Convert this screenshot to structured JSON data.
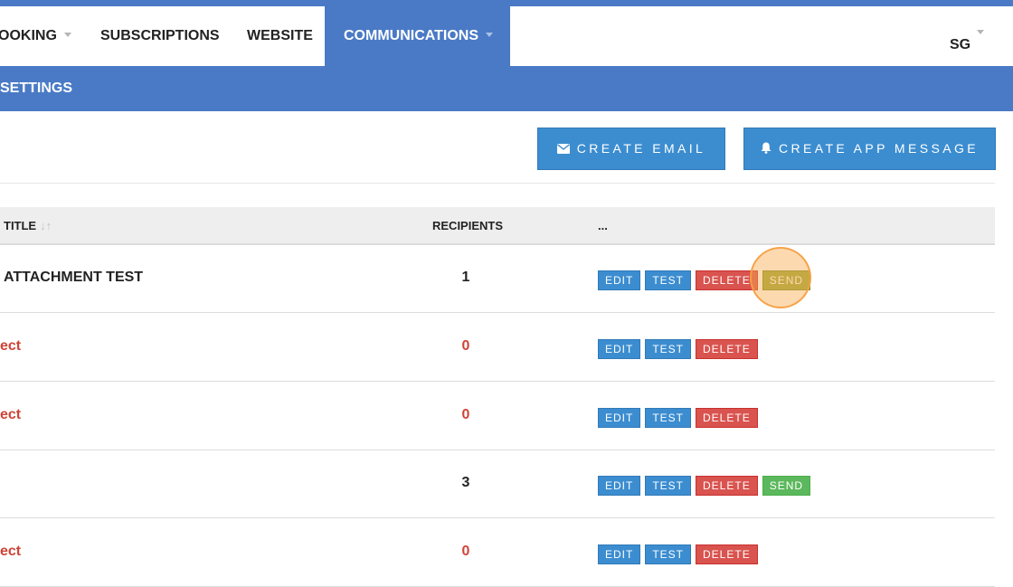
{
  "navbar": {
    "items": [
      {
        "label": "OOKING",
        "has_dropdown": true
      },
      {
        "label": "SUBSCRIPTIONS",
        "has_dropdown": false
      },
      {
        "label": "WEBSITE",
        "has_dropdown": false
      },
      {
        "label": "COMMUNICATIONS",
        "has_dropdown": true,
        "active": true
      }
    ],
    "user_initials": "SG"
  },
  "subnav": {
    "label": "SETTINGS"
  },
  "toolbar": {
    "create_email_label": "CREATE EMAIL",
    "create_email_icon": "envelope-icon",
    "create_app_message_label": "CREATE APP MESSAGE",
    "create_app_message_icon": "bell-icon"
  },
  "table": {
    "columns": {
      "title": "TITLE",
      "recipients": "RECIPIENTS",
      "actions": "..."
    },
    "rows": [
      {
        "title": "ATTACHMENT TEST",
        "recipients": "1",
        "actions": [
          "EDIT",
          "TEST",
          "DELETE",
          "SEND"
        ]
      },
      {
        "title": "ect",
        "recipients": "0",
        "actions": [
          "EDIT",
          "TEST",
          "DELETE"
        ]
      },
      {
        "title": "ect",
        "recipients": "0",
        "actions": [
          "EDIT",
          "TEST",
          "DELETE"
        ]
      },
      {
        "title": "",
        "recipients": "3",
        "actions": [
          "EDIT",
          "TEST",
          "DELETE",
          "SEND"
        ]
      },
      {
        "title": "ect",
        "recipients": "0",
        "actions": [
          "EDIT",
          "TEST",
          "DELETE"
        ]
      }
    ]
  },
  "colors": {
    "brand_blue": "#4a7ac6",
    "button_blue": "#3c8dd0",
    "delete_red": "#d9534f",
    "send_green": "#5cb85c",
    "warning_text_red": "#cf4437",
    "cursor_highlight": "#f5a046"
  }
}
